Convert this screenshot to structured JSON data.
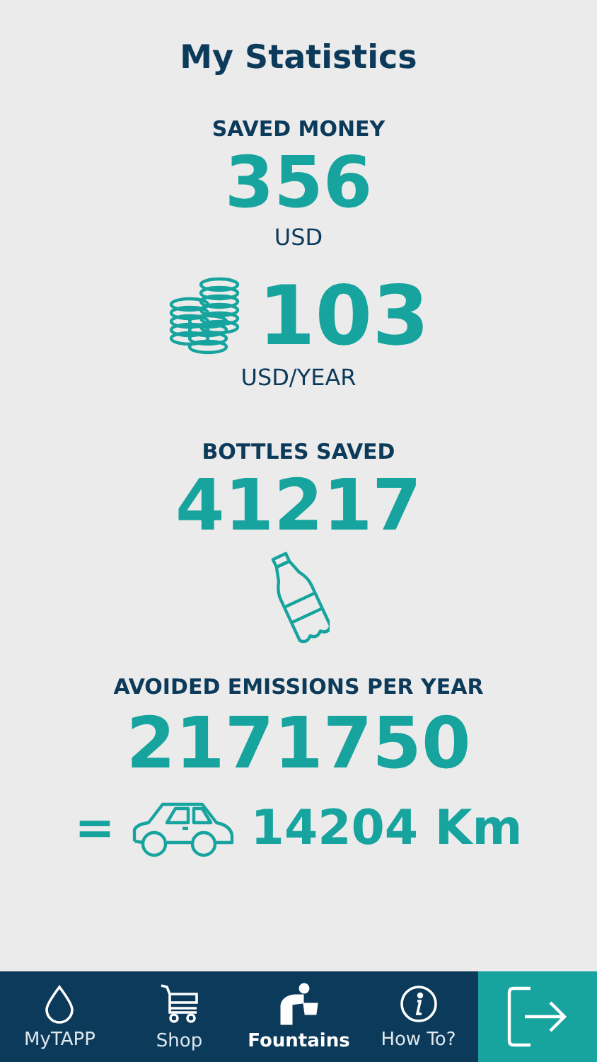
{
  "title": "My Statistics",
  "saved_money": {
    "label": "SAVED MONEY",
    "value": "356",
    "unit": "USD"
  },
  "yearly_money": {
    "value": "103",
    "unit": "USD/YEAR"
  },
  "bottles": {
    "label": "BOTTLES SAVED",
    "value": "41217"
  },
  "emissions": {
    "label": "AVOIDED EMISSIONS PER YEAR",
    "value": "2171750",
    "equals": "=",
    "distance": "14204 Km"
  },
  "tabs": [
    {
      "kind": "drop",
      "label": "MyTAPP",
      "selected": false
    },
    {
      "kind": "cart",
      "label": "Shop",
      "selected": false
    },
    {
      "kind": "fountain",
      "label": "Fountains",
      "selected": true
    },
    {
      "kind": "info",
      "label": "How To?",
      "selected": false
    },
    {
      "kind": "exit"
    }
  ]
}
